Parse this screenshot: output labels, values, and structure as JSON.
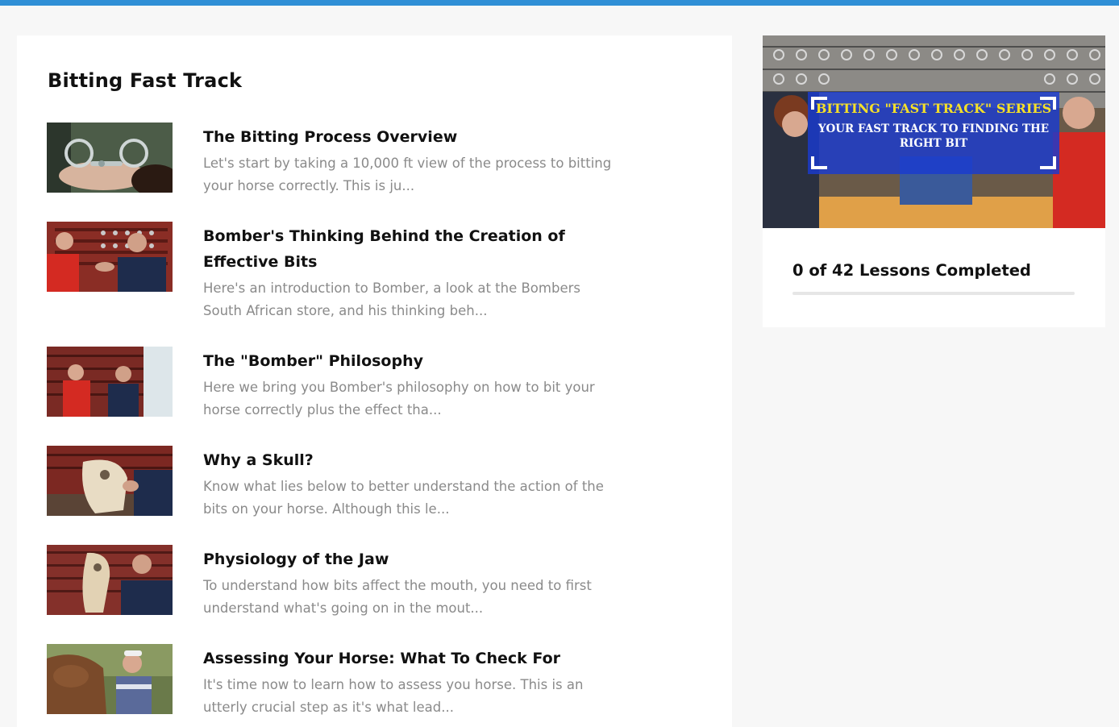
{
  "colors": {
    "accent": "#2f8fd6",
    "banner_title": "#f5e028"
  },
  "course": {
    "title": "Bitting Fast Track"
  },
  "lessons": [
    {
      "title": "The Bitting Process Overview",
      "description": "Let's start by taking a 10,000 ft view of the process to bitting your horse correctly. This is ju...",
      "thumbnail_icon": "bit-in-hand-thumbnail"
    },
    {
      "title": "Bomber's Thinking Behind the Creation of Effective Bits",
      "description": "Here's an introduction to Bomber, a look at the Bombers South African store, and his thinking beh...",
      "thumbnail_icon": "two-men-talking-thumbnail"
    },
    {
      "title": "The \"Bomber\" Philosophy",
      "description": "Here we bring you Bomber's philosophy on how to bit your horse correctly plus the effect tha...",
      "thumbnail_icon": "two-men-in-store-thumbnail"
    },
    {
      "title": "Why a Skull?",
      "description": "Know what lies below to better understand the action of the bits on your horse. Although this le...",
      "thumbnail_icon": "horse-skull-thumbnail"
    },
    {
      "title": "Physiology of the Jaw",
      "description": "To understand how bits affect the mouth, you need to first understand what's going on in the mout...",
      "thumbnail_icon": "jaw-skull-thumbnail"
    },
    {
      "title": "Assessing Your Horse: What To Check For",
      "description": "It's time now to learn how to assess you horse. This is an utterly crucial step as it's what lead...",
      "thumbnail_icon": "horse-outdoors-thumbnail"
    }
  ],
  "sidebar": {
    "banner": {
      "line1": "BITTING \"FAST TRACK\" SERIES",
      "line2": "YOUR FAST TRACK TO FINDING THE RIGHT BIT"
    },
    "progress": {
      "label": "0 of 42 Lessons Completed",
      "fraction": 0
    }
  }
}
